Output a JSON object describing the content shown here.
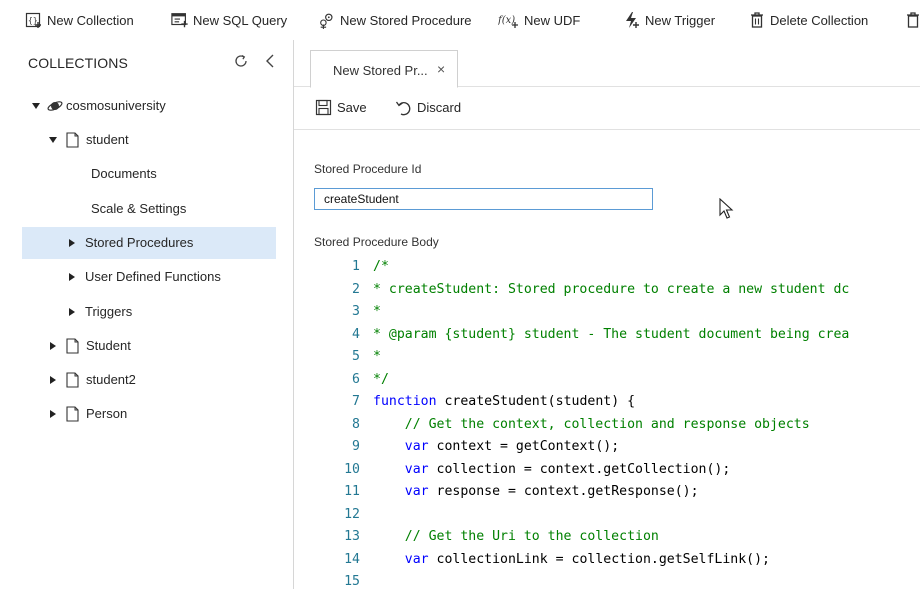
{
  "commandbar": {
    "items": [
      {
        "label": "New Collection",
        "icon": "new-collection-icon"
      },
      {
        "label": "New SQL Query",
        "icon": "new-sql-query-icon"
      },
      {
        "label": "New Stored Procedure",
        "icon": "new-stored-procedure-icon"
      },
      {
        "label": "New UDF",
        "icon": "new-udf-icon"
      },
      {
        "label": "New Trigger",
        "icon": "new-trigger-icon"
      },
      {
        "label": "Delete Collection",
        "icon": "trash-icon"
      }
    ]
  },
  "sidebar": {
    "header": "COLLECTIONS",
    "database": "cosmosuniversity",
    "collections": [
      {
        "label": "student",
        "expanded": true,
        "children": [
          {
            "label": "Documents"
          },
          {
            "label": "Scale & Settings"
          },
          {
            "label": "Stored Procedures",
            "selected": true
          },
          {
            "label": "User Defined Functions"
          },
          {
            "label": "Triggers"
          }
        ]
      },
      {
        "label": "Student"
      },
      {
        "label": "student2"
      },
      {
        "label": "Person"
      }
    ]
  },
  "tabs": [
    {
      "label": "New Stored Pr...",
      "close": "×"
    }
  ],
  "toolbar": {
    "save_label": "Save",
    "discard_label": "Discard"
  },
  "form": {
    "id_label": "Stored Procedure Id",
    "id_value": "createStudent",
    "body_label": "Stored Procedure Body"
  },
  "editor": {
    "lines": [
      "/*",
      "* createStudent: Stored procedure to create a new student dc",
      "*",
      "* @param {student} student - The student document being crea",
      "*",
      "*/",
      "function createStudent(student) {",
      "    // Get the context, collection and response objects",
      "    var context = getContext();",
      "    var collection = context.getCollection();",
      "    var response = context.getResponse();",
      "",
      "    // Get the Uri to the collection",
      "    var collectionLink = collection.getSelfLink();",
      ""
    ]
  },
  "colors": {
    "selection": "#dbe9f8",
    "line_numbers": "#237893",
    "comment": "#008000",
    "keyword": "#0000ff",
    "input_border": "#5b9bd5"
  }
}
